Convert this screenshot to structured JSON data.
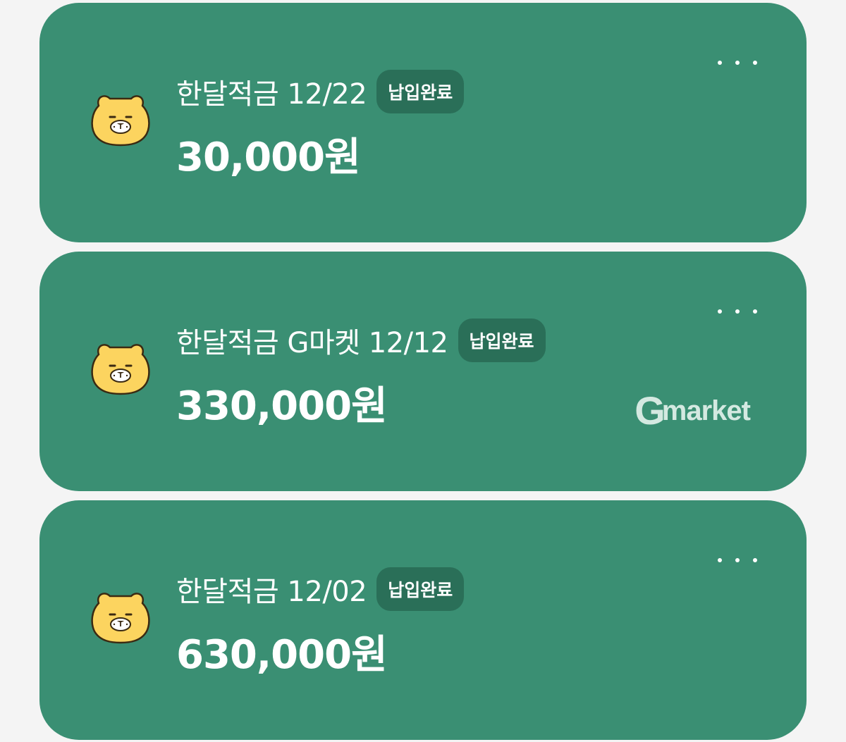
{
  "cards": [
    {
      "title": "한달적금 12/22",
      "badge": "납입완료",
      "amount": "30,000원",
      "menu_icon": "more-horizontal-icon",
      "avatar_icon": "yellow-lion-character-icon"
    },
    {
      "title": "한달적금 G마켓 12/12",
      "badge": "납입완료",
      "amount": "330,000원",
      "menu_icon": "more-horizontal-icon",
      "avatar_icon": "yellow-lion-character-icon",
      "brand_logo": "Gmarket"
    },
    {
      "title": "한달적금 12/02",
      "badge": "납입완료",
      "amount": "630,000원",
      "menu_icon": "more-horizontal-icon",
      "avatar_icon": "yellow-lion-character-icon"
    }
  ],
  "colors": {
    "card_background": "#3a8f73",
    "badge_background": "#2a6f58",
    "page_background": "#f4f4f4",
    "text": "#ffffff",
    "avatar": "#fcd45f"
  }
}
